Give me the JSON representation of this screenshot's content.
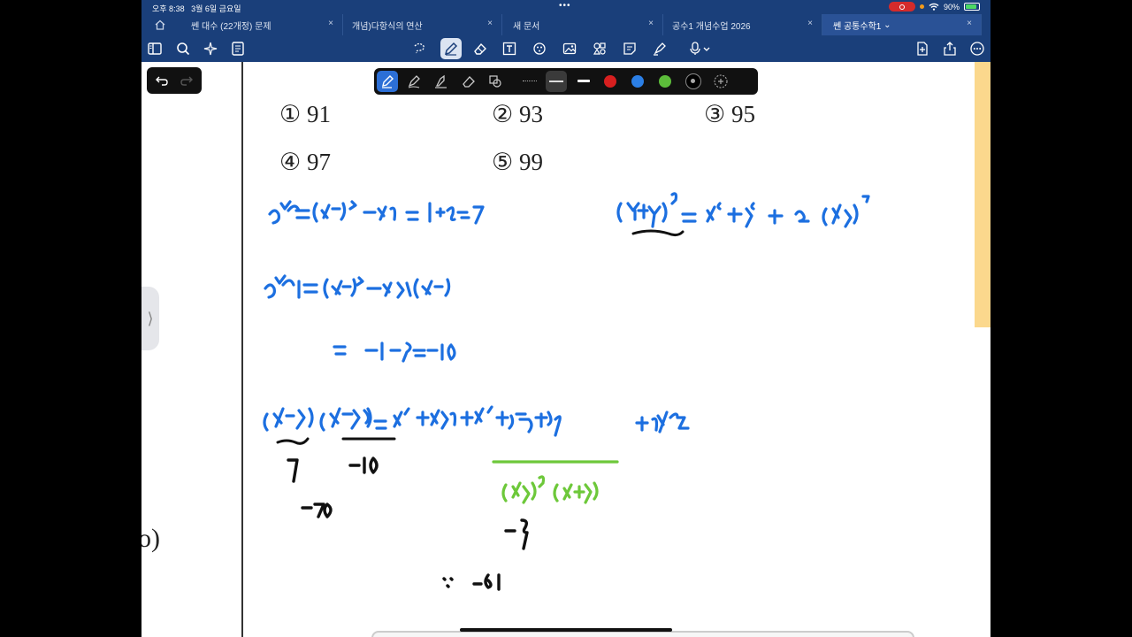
{
  "status_bar": {
    "time": "오후 8:38",
    "date": "3월 6일 금요일",
    "dots": "•••",
    "battery": "90%"
  },
  "tabs": [
    {
      "label": "쎈 대수 (22개정) 문제",
      "active": false
    },
    {
      "label": "개념)다항식의 연산",
      "active": false
    },
    {
      "label": "새 문서",
      "active": false
    },
    {
      "label": "공수1 개념수업 2026",
      "active": false
    },
    {
      "label": "쎈 공통수학1",
      "active": true
    }
  ],
  "tab_close": "×",
  "tab_dropdown": "⌄",
  "choices": [
    {
      "num": "①",
      "value": "91"
    },
    {
      "num": "②",
      "value": "93"
    },
    {
      "num": "③",
      "value": "95"
    },
    {
      "num": "④",
      "value": "97"
    },
    {
      "num": "⑤",
      "value": "99"
    }
  ],
  "side_handle": "⟩",
  "left_fragment": "o)",
  "colors": {
    "bar": "#1a3f7a",
    "ink_blue": "#1c6fe0",
    "ink_green": "#6dc83a",
    "ink_black": "#111111",
    "swatch_red": "#d71f1f",
    "swatch_blue": "#2b7fe6",
    "swatch_green": "#5cbc3a"
  },
  "icons": [
    "home-icon",
    "sidebar-icon",
    "search-icon",
    "sparkle-icon",
    "doc-outline-icon",
    "lasso-icon",
    "pen-icon",
    "eraser-icon",
    "textbox-icon",
    "shapes-icon",
    "image-icon",
    "elements-icon",
    "sticky-note-icon",
    "highlighter-icon",
    "mic-icon",
    "new-page-icon",
    "share-icon",
    "more-icon",
    "undo-icon",
    "redo-icon"
  ]
}
